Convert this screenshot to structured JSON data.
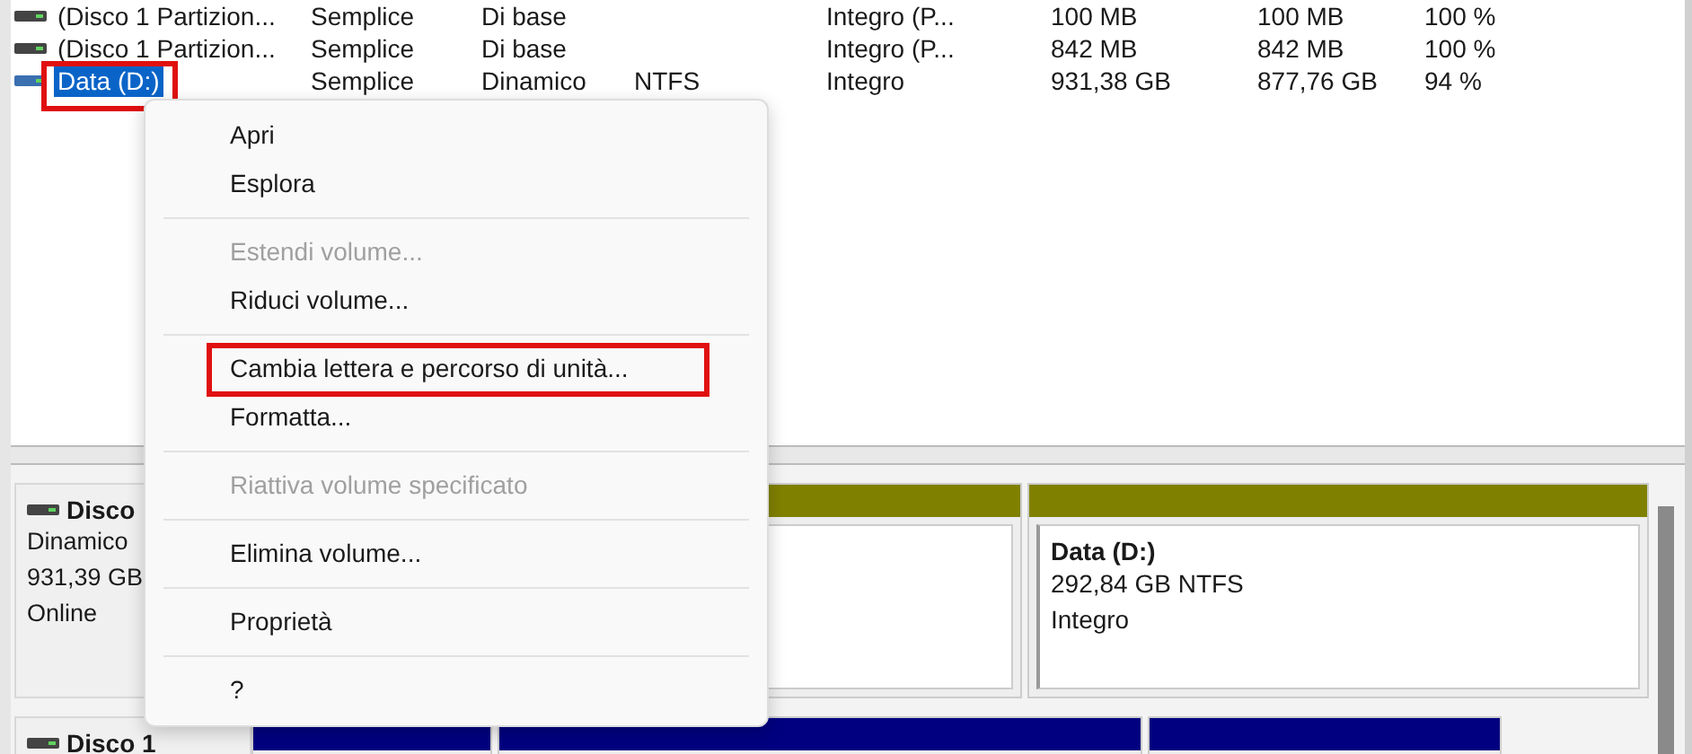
{
  "volumes": {
    "rows": [
      {
        "name": "(Disco 1 Partizion...",
        "layout": "Semplice",
        "type": "Di base",
        "status": "Integro (P...",
        "capacity": "100 MB",
        "free": "100 MB",
        "percent_free": "100 %",
        "selected": false,
        "highlighted": false
      },
      {
        "name": "(Disco 1 Partizion...",
        "layout": "Semplice",
        "type": "Di base",
        "status": "Integro (P...",
        "capacity": "842 MB",
        "free": "842 MB",
        "percent_free": "100 %",
        "selected": false,
        "highlighted": false
      },
      {
        "name": "Data (D:)",
        "layout": "Semplice",
        "type": "Dinamico",
        "file_system": "NTFS",
        "status": "Integro",
        "capacity": "931,38 GB",
        "free": "877,76 GB",
        "percent_free": "94 %",
        "selected": true,
        "highlighted": true
      }
    ]
  },
  "disks": [
    {
      "name": "Disco",
      "lines": [
        "Dinamico",
        "931,39 GB",
        "Online"
      ],
      "partitions": [
        {
          "kind": "dynamic"
        },
        {
          "kind": "dynamic",
          "title": "Data  (D:)",
          "lines": [
            "292,84 GB NTFS",
            "Integro"
          ]
        }
      ]
    },
    {
      "name": "Disco 1",
      "partitions": [
        {
          "kind": "basic"
        },
        {
          "kind": "basic"
        },
        {
          "kind": "basic"
        }
      ]
    }
  ],
  "context_menu": {
    "items": [
      {
        "kind": "item",
        "label": "Apri",
        "disabled": false,
        "highlighted": false
      },
      {
        "kind": "item",
        "label": "Esplora",
        "disabled": false,
        "highlighted": false
      },
      {
        "kind": "separator"
      },
      {
        "kind": "item",
        "label": "Estendi volume...",
        "disabled": true,
        "highlighted": false
      },
      {
        "kind": "item",
        "label": "Riduci volume...",
        "disabled": false,
        "highlighted": false
      },
      {
        "kind": "separator"
      },
      {
        "kind": "item",
        "label": "Cambia lettera e percorso di unità...",
        "disabled": false,
        "highlighted": true
      },
      {
        "kind": "item",
        "label": "Formatta...",
        "disabled": false,
        "highlighted": false
      },
      {
        "kind": "separator"
      },
      {
        "kind": "item",
        "label": "Riattiva volume specificato",
        "disabled": true,
        "highlighted": false
      },
      {
        "kind": "separator"
      },
      {
        "kind": "item",
        "label": "Elimina volume...",
        "disabled": false,
        "highlighted": false
      },
      {
        "kind": "separator"
      },
      {
        "kind": "item",
        "label": "Proprietà",
        "disabled": false,
        "highlighted": false
      },
      {
        "kind": "separator"
      },
      {
        "kind": "item",
        "label": "?",
        "disabled": false,
        "highlighted": false
      }
    ]
  }
}
